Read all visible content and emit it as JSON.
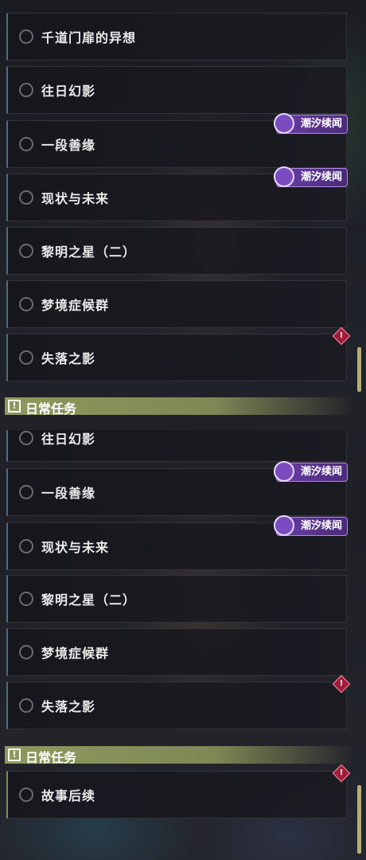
{
  "top_panel": {
    "quests": [
      {
        "title": "千道门扉的异想",
        "tag": "",
        "alert": false
      },
      {
        "title": "往日幻影",
        "tag": "",
        "alert": false
      },
      {
        "title": "一段善缘",
        "tag": "潮汐续闻",
        "alert": false
      },
      {
        "title": "现状与未来",
        "tag": "潮汐续闻",
        "alert": false
      },
      {
        "title": "黎明之星（二）",
        "tag": "",
        "alert": false
      },
      {
        "title": "梦境症候群",
        "tag": "",
        "alert": false
      },
      {
        "title": "失落之影",
        "tag": "",
        "alert": true
      }
    ],
    "section": {
      "icon": "!",
      "label": "日常任务"
    }
  },
  "bottom_panel": {
    "quests": [
      {
        "title": "往日幻影",
        "tag": "",
        "alert": false
      },
      {
        "title": "一段善缘",
        "tag": "潮汐续闻",
        "alert": false
      },
      {
        "title": "现状与未来",
        "tag": "潮汐续闻",
        "alert": false
      },
      {
        "title": "黎明之星（二）",
        "tag": "",
        "alert": false
      },
      {
        "title": "梦境症候群",
        "tag": "",
        "alert": false
      },
      {
        "title": "失落之影",
        "tag": "",
        "alert": true
      }
    ],
    "section": {
      "icon": "!",
      "label": "日常任务"
    },
    "daily_quests": [
      {
        "title": "故事后续",
        "tag": "",
        "alert": true
      }
    ]
  },
  "alert_glyph": "!",
  "colors": {
    "tag_purple": "#6a3ea6",
    "daily_green": "#8d9a5c",
    "alert_red": "#a01e3a",
    "card_border_blue": "#4f6b82"
  }
}
